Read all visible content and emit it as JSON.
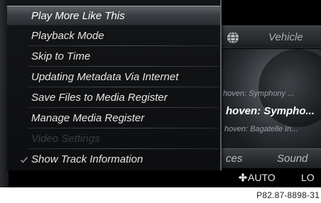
{
  "menu": {
    "items": [
      {
        "label": "Play More Like This",
        "state": "selected"
      },
      {
        "label": "Playback Mode",
        "state": "normal"
      },
      {
        "label": "Skip to Time",
        "state": "normal"
      },
      {
        "label": "Updating Metadata Via Internet",
        "state": "normal"
      },
      {
        "label": "Save Files to Media Register",
        "state": "normal"
      },
      {
        "label": "Manage Media Register",
        "state": "normal"
      },
      {
        "label": "Video Settings",
        "state": "disabled"
      },
      {
        "label": "Show Track Information",
        "state": "checked"
      }
    ]
  },
  "player": {
    "source_label": "Vehicle",
    "globe_icon": "globe-icon",
    "tracks": {
      "previous": "hoven: Symphony ...",
      "current": "hoven: Sympho...",
      "next": "hoven: Bagatelle In..."
    },
    "bottom_bar": {
      "services_label": "ces",
      "sound_label": "Sound"
    }
  },
  "climate": {
    "fan_icon": "fan-icon",
    "auto_label": "AUTO",
    "level_label": "LO"
  },
  "caption": "P82.87-8898-31",
  "colors": {
    "selected_highlight": "#4a4e53",
    "menu_text": "#e6e6e6",
    "disabled_text": "#3a3c40",
    "screen_bg": "#000000"
  }
}
